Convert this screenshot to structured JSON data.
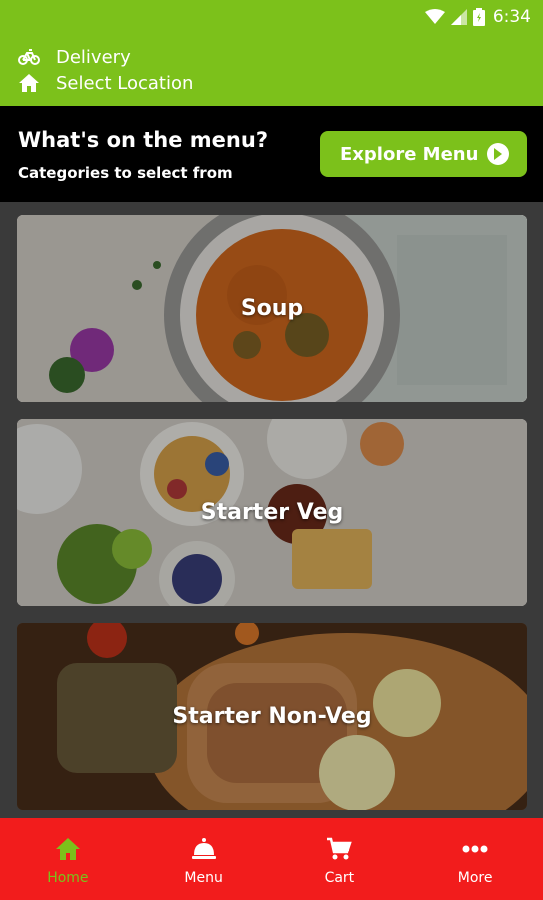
{
  "status_bar": {
    "time": "6:34"
  },
  "header": {
    "delivery_label": "Delivery",
    "location_label": "Select Location"
  },
  "banner": {
    "title": "What's on the menu?",
    "subtitle": "Categories to select from",
    "explore_label": "Explore Menu"
  },
  "categories": [
    {
      "label": "Soup"
    },
    {
      "label": "Starter Veg"
    },
    {
      "label": "Starter Non-Veg"
    }
  ],
  "bottom_nav": [
    {
      "label": "Home",
      "icon": "home-icon",
      "active": true
    },
    {
      "label": "Menu",
      "icon": "cloche-icon",
      "active": false
    },
    {
      "label": "Cart",
      "icon": "cart-icon",
      "active": false
    },
    {
      "label": "More",
      "icon": "more-icon",
      "active": false
    }
  ],
  "colors": {
    "brand_green": "#7cc11b",
    "nav_red": "#f21c1c",
    "banner_black": "#000000",
    "background": "#3a3a3a"
  }
}
